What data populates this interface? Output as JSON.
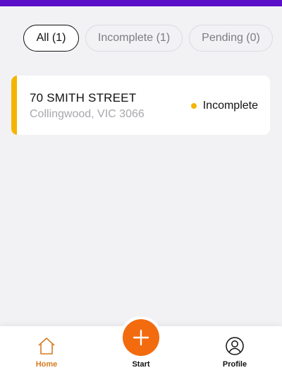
{
  "filters": {
    "all": "All (1)",
    "incomplete": "Incomplete (1)",
    "pending": "Pending (0)"
  },
  "job_card": {
    "title": "70 SMITH STREET",
    "subtitle": "Collingwood, VIC 3066",
    "status": "Incomplete",
    "status_color": "#f5b400"
  },
  "tabbar": {
    "home_label": "Home",
    "start_label": "Start",
    "profile_label": "Profile",
    "home_icon": "home-icon",
    "start_icon": "plus-icon",
    "profile_icon": "user-circle-icon"
  },
  "colors": {
    "header": "#5a0fc8",
    "accent_orange": "#f26b0f",
    "active_tab": "#d87a1f",
    "status_incomplete": "#f5b400"
  }
}
